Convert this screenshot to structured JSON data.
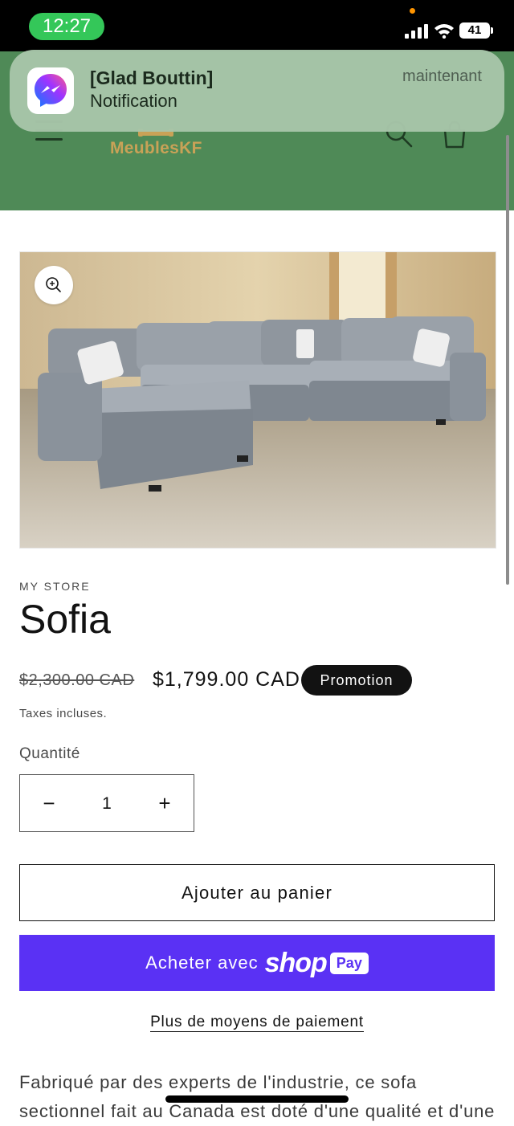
{
  "status_bar": {
    "time": "12:27",
    "battery": "41",
    "icons": [
      "signal-bars-icon",
      "wifi-icon",
      "battery-icon"
    ],
    "time_pill_color": "#34c759"
  },
  "notification": {
    "app_icon": "messenger-icon",
    "title": "[Glad Bouttin]",
    "body": "Notification",
    "time": "maintenant"
  },
  "header": {
    "logo_text": "MeublesKF",
    "background_color": "#4f8a57",
    "icons": [
      "menu-icon",
      "search-icon",
      "cart-icon"
    ]
  },
  "product": {
    "image_description_icon": "zoom-icon",
    "vendor": "MY STORE",
    "title": "Sofia",
    "compare_price": "$2,300.00 CAD",
    "price": "$1,799.00 CAD",
    "sale_badge": "Promotion",
    "tax_note": "Taxes incluses.",
    "quantity_label": "Quantité",
    "quantity_value": "1",
    "quantity_minus": "−",
    "quantity_plus": "+",
    "add_to_cart": "Ajouter au panier",
    "shop_pay": {
      "prefix": "Acheter avec",
      "brand": "shop",
      "badge": "Pay",
      "color": "#5a31f4"
    },
    "more_payment": "Plus de moyens de paiement",
    "description": "Fabriqué par des experts de l'industrie, ce sofa sectionnel fait au Canada est doté d'une qualité et d'une"
  }
}
